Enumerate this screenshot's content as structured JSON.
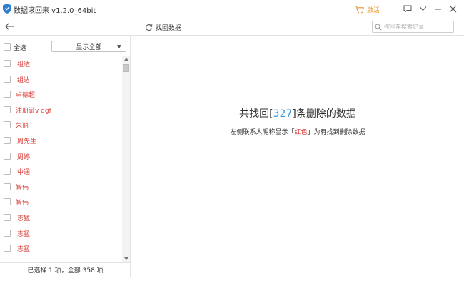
{
  "window": {
    "title": "数据滚回来 v1.2.0_64bit",
    "activate_label": "激活",
    "colors": {
      "accent": "#3a9ad9",
      "deleted": "#d9403a",
      "activate": "#e8962f"
    }
  },
  "toolbar": {
    "recover_label": "找回数据",
    "search_placeholder": "按回车搜索记录"
  },
  "left_panel": {
    "select_all_label": "全选",
    "filter_value": "显示全部",
    "items": [
      {
        "name": "组达"
      },
      {
        "name": "组达"
      },
      {
        "name": "卓德超"
      },
      {
        "name": "注册证v dgf"
      },
      {
        "name": "朱丽"
      },
      {
        "name": "周先生"
      },
      {
        "name": "周婷"
      },
      {
        "name": "中通"
      },
      {
        "name": "智伟"
      },
      {
        "name": "智伟"
      },
      {
        "name": "志猛"
      },
      {
        "name": "志猛"
      },
      {
        "name": "志猛"
      }
    ],
    "status": "已选择 1 项，全部 358 项"
  },
  "main": {
    "headline_prefix": "共找回[",
    "count": "327",
    "headline_suffix": "]条删除的数据",
    "subtext_prefix": "左侧联系人昵称显示「",
    "subtext_red": "红色",
    "subtext_suffix": "」为有找到删除数据"
  }
}
